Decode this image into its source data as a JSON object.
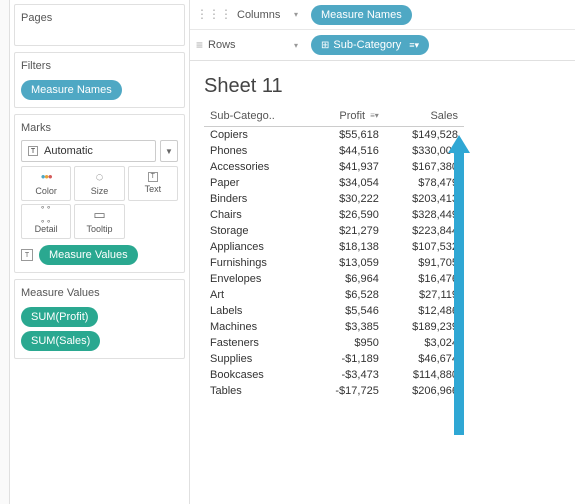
{
  "sidebar": {
    "pages_title": "Pages",
    "filters_title": "Filters",
    "filters": {
      "pill0": "Measure Names"
    },
    "marks_title": "Marks",
    "marks_type": "Automatic",
    "mark_cells": {
      "color": "Color",
      "size": "Size",
      "text": "Text",
      "detail": "Detail",
      "tooltip": "Tooltip"
    },
    "marks_footer_pill": "Measure Values",
    "mv_title": "Measure Values",
    "mv": {
      "pill0": "SUM(Profit)",
      "pill1": "SUM(Sales)"
    }
  },
  "shelves": {
    "columns_label": "Columns",
    "columns_pill": "Measure Names",
    "rows_label": "Rows",
    "rows_pill": "Sub-Category"
  },
  "sheet": {
    "title": "Sheet 11",
    "headers": {
      "subcat": "Sub-Catego..",
      "profit": "Profit",
      "sales": "Sales"
    },
    "rows": [
      {
        "c": "Copiers",
        "p": "$55,618",
        "s": "$149,528"
      },
      {
        "c": "Phones",
        "p": "$44,516",
        "s": "$330,007"
      },
      {
        "c": "Accessories",
        "p": "$41,937",
        "s": "$167,380"
      },
      {
        "c": "Paper",
        "p": "$34,054",
        "s": "$78,479"
      },
      {
        "c": "Binders",
        "p": "$30,222",
        "s": "$203,413"
      },
      {
        "c": "Chairs",
        "p": "$26,590",
        "s": "$328,449"
      },
      {
        "c": "Storage",
        "p": "$21,279",
        "s": "$223,844"
      },
      {
        "c": "Appliances",
        "p": "$18,138",
        "s": "$107,532"
      },
      {
        "c": "Furnishings",
        "p": "$13,059",
        "s": "$91,705"
      },
      {
        "c": "Envelopes",
        "p": "$6,964",
        "s": "$16,476"
      },
      {
        "c": "Art",
        "p": "$6,528",
        "s": "$27,119"
      },
      {
        "c": "Labels",
        "p": "$5,546",
        "s": "$12,486"
      },
      {
        "c": "Machines",
        "p": "$3,385",
        "s": "$189,239"
      },
      {
        "c": "Fasteners",
        "p": "$950",
        "s": "$3,024"
      },
      {
        "c": "Supplies",
        "p": "-$1,189",
        "s": "$46,674"
      },
      {
        "c": "Bookcases",
        "p": "-$3,473",
        "s": "$114,880"
      },
      {
        "c": "Tables",
        "p": "-$17,725",
        "s": "$206,966"
      }
    ]
  },
  "chart_data": {
    "type": "table",
    "title": "Sheet 11",
    "sort": {
      "column": "Profit",
      "direction": "descending"
    },
    "columns": [
      "Sub-Category",
      "Profit",
      "Sales"
    ],
    "rows": [
      {
        "Sub-Category": "Copiers",
        "Profit": 55618,
        "Sales": 149528
      },
      {
        "Sub-Category": "Phones",
        "Profit": 44516,
        "Sales": 330007
      },
      {
        "Sub-Category": "Accessories",
        "Profit": 41937,
        "Sales": 167380
      },
      {
        "Sub-Category": "Paper",
        "Profit": 34054,
        "Sales": 78479
      },
      {
        "Sub-Category": "Binders",
        "Profit": 30222,
        "Sales": 203413
      },
      {
        "Sub-Category": "Chairs",
        "Profit": 26590,
        "Sales": 328449
      },
      {
        "Sub-Category": "Storage",
        "Profit": 21279,
        "Sales": 223844
      },
      {
        "Sub-Category": "Appliances",
        "Profit": 18138,
        "Sales": 107532
      },
      {
        "Sub-Category": "Furnishings",
        "Profit": 13059,
        "Sales": 91705
      },
      {
        "Sub-Category": "Envelopes",
        "Profit": 6964,
        "Sales": 16476
      },
      {
        "Sub-Category": "Art",
        "Profit": 6528,
        "Sales": 27119
      },
      {
        "Sub-Category": "Labels",
        "Profit": 5546,
        "Sales": 12486
      },
      {
        "Sub-Category": "Machines",
        "Profit": 3385,
        "Sales": 189239
      },
      {
        "Sub-Category": "Fasteners",
        "Profit": 950,
        "Sales": 3024
      },
      {
        "Sub-Category": "Supplies",
        "Profit": -1189,
        "Sales": 46674
      },
      {
        "Sub-Category": "Bookcases",
        "Profit": -3473,
        "Sales": 114880
      },
      {
        "Sub-Category": "Tables",
        "Profit": -17725,
        "Sales": 206966
      }
    ]
  }
}
